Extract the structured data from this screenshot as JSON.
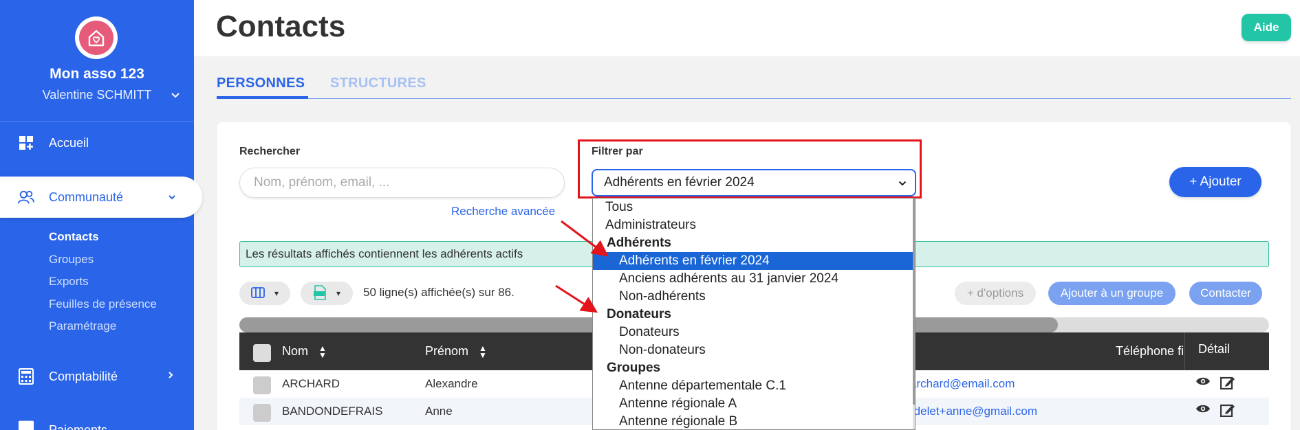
{
  "sidebar": {
    "org_name": "Mon asso 123",
    "user_name": "Valentine SCHMITT",
    "nav": [
      {
        "label": "Accueil",
        "icon": "dashboard-icon"
      },
      {
        "label": "Communauté",
        "icon": "users-icon"
      },
      {
        "label": "Comptabilité",
        "icon": "calculator-icon"
      },
      {
        "label": "Paiements",
        "icon": "card-icon"
      }
    ],
    "sub_items": [
      "Contacts",
      "Groupes",
      "Exports",
      "Feuilles de présence",
      "Paramétrage"
    ]
  },
  "header": {
    "title": "Contacts",
    "help_label": "Aide"
  },
  "tabs": [
    {
      "label": "PERSONNES"
    },
    {
      "label": "STRUCTURES"
    }
  ],
  "search": {
    "label": "Rechercher",
    "placeholder": "Nom, prénom, email, ...",
    "advanced_link": "Recherche avancée"
  },
  "filter": {
    "label": "Filtrer par",
    "selected": "Adhérents en février 2024"
  },
  "add_button": "+ Ajouter",
  "info_banner": "Les résultats affichés contiennent les adhérents actifs",
  "toolbar": {
    "rows_info": "50 ligne(s) affichée(s) sur 86.",
    "more_options": "+ d'options",
    "add_to_group": "Ajouter à un groupe",
    "contact": "Contacter"
  },
  "table": {
    "columns": {
      "nom": "Nom",
      "prenom": "Prénom",
      "telephone": "Téléphone fi",
      "detail": "Détail"
    },
    "rows": [
      {
        "nom": "ARCHARD",
        "prenom": "Alexandre",
        "email": "archard@email.com"
      },
      {
        "nom": "BANDONDEFRAIS",
        "prenom": "Anne",
        "email": "rdelet+anne@gmail.com"
      }
    ]
  },
  "dropdown": {
    "items": [
      {
        "label": "Tous",
        "kind": "option"
      },
      {
        "label": "Administrateurs",
        "kind": "option"
      },
      {
        "label": "Adhérents",
        "kind": "group"
      },
      {
        "label": "Adhérents en février 2024",
        "kind": "sub",
        "selected": true
      },
      {
        "label": "Anciens adhérents au 31 janvier 2024",
        "kind": "sub"
      },
      {
        "label": "Non-adhérents",
        "kind": "sub"
      },
      {
        "label": "Donateurs",
        "kind": "group"
      },
      {
        "label": "Donateurs",
        "kind": "sub"
      },
      {
        "label": "Non-donateurs",
        "kind": "sub"
      },
      {
        "label": "Groupes",
        "kind": "group"
      },
      {
        "label": "Antenne départementale C.1",
        "kind": "sub"
      },
      {
        "label": "Antenne régionale A",
        "kind": "sub"
      },
      {
        "label": "Antenne régionale B",
        "kind": "sub"
      }
    ]
  },
  "colors": {
    "primary": "#2a64e8",
    "help": "#22c5a5",
    "highlight_box": "#e3151b",
    "banner_bg": "#d5f1ea",
    "selected_option": "#1a66d6",
    "logo_pink": "#e65a7a"
  }
}
